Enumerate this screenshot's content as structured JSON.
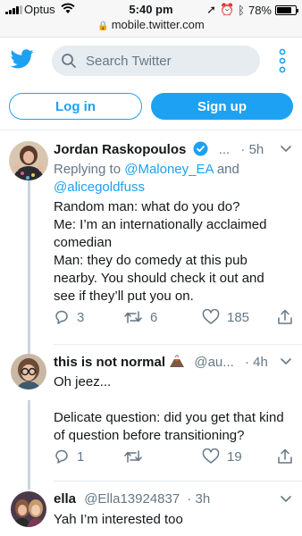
{
  "status_bar": {
    "carrier": "Optus",
    "time": "5:40 pm",
    "battery_percent": "78%",
    "battery_level": 0.78
  },
  "browser": {
    "url": "mobile.twitter.com"
  },
  "header": {
    "logo_icon": "twitter-bird-icon",
    "search_placeholder": "Search Twitter",
    "more_icon": "vertical-dots-icon"
  },
  "auth": {
    "login_label": "Log in",
    "signup_label": "Sign up"
  },
  "colors": {
    "brand": "#1da1f2",
    "muted": "#657786",
    "text": "#14171a"
  },
  "tweets": [
    {
      "name": "Jordan Raskopoulos",
      "verified": true,
      "handle": "...",
      "time": "5h",
      "reply_prefix": "Replying to",
      "reply_user_1": "@Maloney_EA",
      "reply_joiner": "and",
      "reply_user_2": "@alicegoldfuss",
      "text": "Random man: what do you do?\nMe: I’m an internationally acclaimed comedian\nMan: they do comedy at this pub nearby. You should check it out and see if they’ll put you on.",
      "replies": "3",
      "retweets": "6",
      "likes": "185"
    },
    {
      "name": "this is not normal",
      "handle": "@au...",
      "time": "4h",
      "text": "Oh jeez...\n\nDelicate question: did you get that kind of question before transitioning?",
      "replies": "1",
      "retweets": "",
      "likes": "19"
    },
    {
      "name": "ella",
      "handle": "@Ella13924837",
      "time": "3h",
      "text": "Yah I’m interested too"
    }
  ]
}
